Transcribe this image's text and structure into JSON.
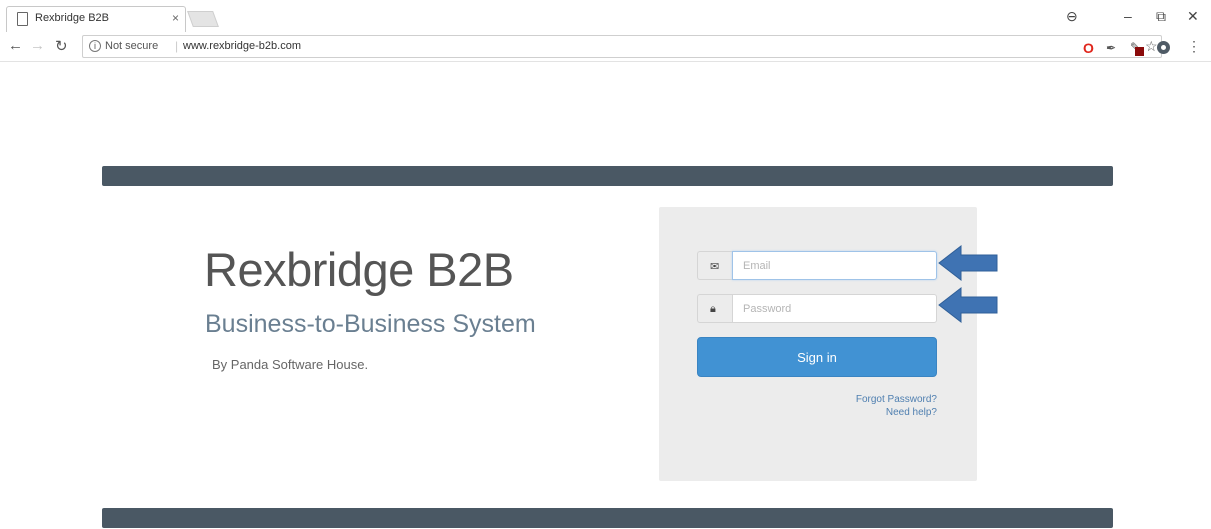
{
  "browser": {
    "tab_title": "Rexbridge B2B",
    "tab_close": "×",
    "security_label": "Not secure",
    "url": "www.rexbridge-b2b.com"
  },
  "page": {
    "title": "Rexbridge B2B",
    "subtitle": "Business-to-Business System",
    "byline": "By Panda Software House."
  },
  "login": {
    "email_placeholder": "Email",
    "password_placeholder": "Password",
    "signin_label": "Sign in",
    "forgot_label": "Forgot Password?",
    "help_label": "Need help?"
  },
  "colors": {
    "header_bar": "#4a5864",
    "signin_button": "#4192d3",
    "arrow": "#3f73b3"
  },
  "icons": {
    "email_addon": "envelope-icon",
    "password_addon": "lock-icon"
  }
}
